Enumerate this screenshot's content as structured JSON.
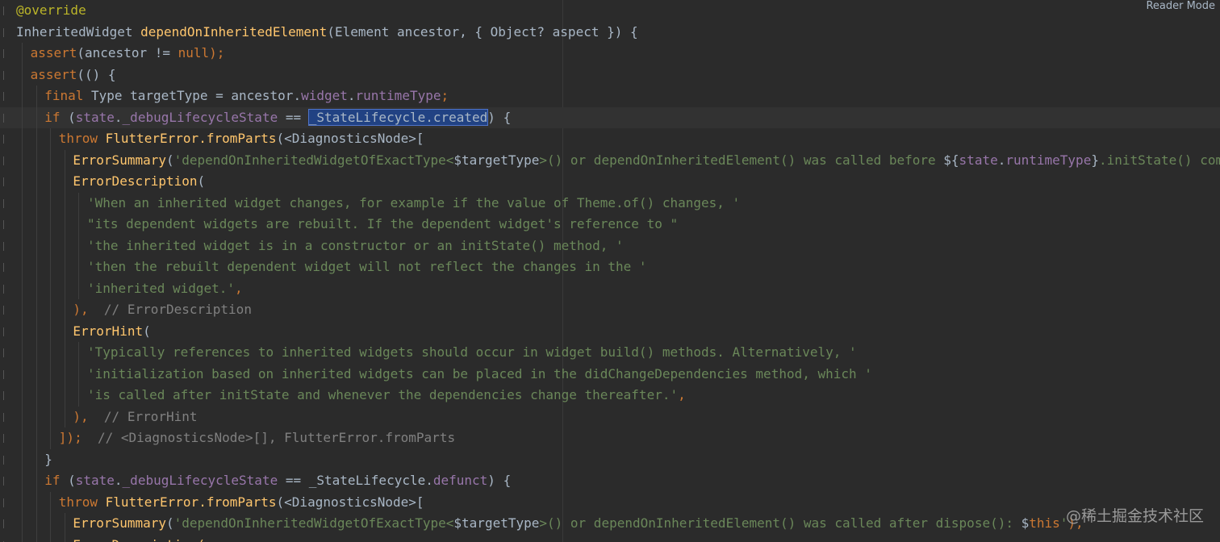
{
  "editor": {
    "reader_mode_label": "Reader Mode",
    "watermark": "@稀土掘金技术社区",
    "colors": {
      "background": "#2b2b2b",
      "plain": "#a9b7c6",
      "keyword": "#cc7832",
      "function": "#ffc66d",
      "field": "#9876aa",
      "string": "#6a8759",
      "comment": "#808080",
      "annotation": "#bbb529",
      "selection": "#214283"
    },
    "lines": [
      {
        "indent": 0,
        "tokens": [
          {
            "t": "@override",
            "c": "anno"
          }
        ]
      },
      {
        "indent": 0,
        "tokens": [
          {
            "t": "InheritedWidget ",
            "c": "plain"
          },
          {
            "t": "dependOnInheritedElement",
            "c": "fn"
          },
          {
            "t": "(Element ancestor, { Object? aspect }) {",
            "c": "plain"
          }
        ]
      },
      {
        "indent": 1,
        "tokens": [
          {
            "t": "assert",
            "c": "kw"
          },
          {
            "t": "(ancestor != ",
            "c": "plain"
          },
          {
            "t": "null",
            "c": "kw"
          },
          {
            "t": ");",
            "c": "kw"
          }
        ]
      },
      {
        "indent": 1,
        "tokens": [
          {
            "t": "assert",
            "c": "kw"
          },
          {
            "t": "(() {",
            "c": "plain"
          }
        ]
      },
      {
        "indent": 2,
        "tokens": [
          {
            "t": "final ",
            "c": "kw"
          },
          {
            "t": "Type targetType = ancestor.",
            "c": "plain"
          },
          {
            "t": "widget",
            "c": "field"
          },
          {
            "t": ".",
            "c": "plain"
          },
          {
            "t": "runtimeType",
            "c": "field"
          },
          {
            "t": ";",
            "c": "kw"
          }
        ]
      },
      {
        "indent": 2,
        "current": true,
        "tokens": [
          {
            "t": "if ",
            "c": "kw"
          },
          {
            "t": "(",
            "c": "plain"
          },
          {
            "t": "state",
            "c": "field"
          },
          {
            "t": ".",
            "c": "plain"
          },
          {
            "t": "_debugLifecycleState",
            "c": "field"
          },
          {
            "t": " == ",
            "c": "plain"
          },
          {
            "t": "_StateLifecycle.created",
            "c": "sel"
          },
          {
            "t": ") {",
            "c": "plain"
          }
        ]
      },
      {
        "indent": 3,
        "tokens": [
          {
            "t": "throw ",
            "c": "kw"
          },
          {
            "t": "FlutterError.",
            "c": "fn"
          },
          {
            "t": "fromParts",
            "c": "fn"
          },
          {
            "t": "(<DiagnosticsNode>[",
            "c": "plain"
          }
        ]
      },
      {
        "indent": 4,
        "tokens": [
          {
            "t": "ErrorSummary",
            "c": "fn"
          },
          {
            "t": "(",
            "c": "plain"
          },
          {
            "t": "'dependOnInheritedWidgetOfExactType<",
            "c": "str"
          },
          {
            "t": "$targetType",
            "c": "plain"
          },
          {
            "t": ">() or dependOnInheritedElement() was called before ",
            "c": "str"
          },
          {
            "t": "${",
            "c": "plain"
          },
          {
            "t": "state",
            "c": "field"
          },
          {
            "t": ".",
            "c": "plain"
          },
          {
            "t": "runtimeType",
            "c": "field"
          },
          {
            "t": "}",
            "c": "plain"
          },
          {
            "t": ".initState() completed.'",
            "c": "str"
          },
          {
            "t": "),",
            "c": "kw"
          }
        ]
      },
      {
        "indent": 4,
        "tokens": [
          {
            "t": "ErrorDescription",
            "c": "fn"
          },
          {
            "t": "(",
            "c": "plain"
          }
        ]
      },
      {
        "indent": 5,
        "tokens": [
          {
            "t": "'When an inherited widget changes, for example if the value of Theme.of() changes, '",
            "c": "str"
          }
        ]
      },
      {
        "indent": 5,
        "tokens": [
          {
            "t": "\"its dependent widgets are rebuilt. If the dependent widget's reference to \"",
            "c": "str"
          }
        ]
      },
      {
        "indent": 5,
        "tokens": [
          {
            "t": "'the inherited widget is in a constructor or an initState() method, '",
            "c": "str"
          }
        ]
      },
      {
        "indent": 5,
        "tokens": [
          {
            "t": "'then the rebuilt dependent widget will not reflect the changes in the '",
            "c": "str"
          }
        ]
      },
      {
        "indent": 5,
        "tokens": [
          {
            "t": "'inherited widget.'",
            "c": "str"
          },
          {
            "t": ",",
            "c": "kw"
          }
        ]
      },
      {
        "indent": 4,
        "tokens": [
          {
            "t": "),",
            "c": "kw"
          },
          {
            "t": "  // ErrorDescription",
            "c": "com"
          }
        ]
      },
      {
        "indent": 4,
        "tokens": [
          {
            "t": "ErrorHint",
            "c": "fn"
          },
          {
            "t": "(",
            "c": "plain"
          }
        ]
      },
      {
        "indent": 5,
        "tokens": [
          {
            "t": "'Typically references to inherited widgets should occur in widget build() methods. Alternatively, '",
            "c": "str"
          }
        ]
      },
      {
        "indent": 5,
        "tokens": [
          {
            "t": "'initialization based on inherited widgets can be placed in the didChangeDependencies method, which '",
            "c": "str"
          }
        ]
      },
      {
        "indent": 5,
        "tokens": [
          {
            "t": "'is called after initState and whenever the dependencies change thereafter.'",
            "c": "str"
          },
          {
            "t": ",",
            "c": "kw"
          }
        ]
      },
      {
        "indent": 4,
        "tokens": [
          {
            "t": "),",
            "c": "kw"
          },
          {
            "t": "  // ErrorHint",
            "c": "com"
          }
        ]
      },
      {
        "indent": 3,
        "tokens": [
          {
            "t": "]);",
            "c": "kw"
          },
          {
            "t": "  // <DiagnosticsNode>[], FlutterError.fromParts",
            "c": "com"
          }
        ]
      },
      {
        "indent": 2,
        "tokens": [
          {
            "t": "}",
            "c": "plain"
          }
        ]
      },
      {
        "indent": 2,
        "tokens": [
          {
            "t": "if ",
            "c": "kw"
          },
          {
            "t": "(",
            "c": "plain"
          },
          {
            "t": "state",
            "c": "field"
          },
          {
            "t": ".",
            "c": "plain"
          },
          {
            "t": "_debugLifecycleState",
            "c": "field"
          },
          {
            "t": " == _StateLifecycle.",
            "c": "plain"
          },
          {
            "t": "defunct",
            "c": "field"
          },
          {
            "t": ") {",
            "c": "plain"
          }
        ]
      },
      {
        "indent": 3,
        "tokens": [
          {
            "t": "throw ",
            "c": "kw"
          },
          {
            "t": "FlutterError.",
            "c": "fn"
          },
          {
            "t": "fromParts",
            "c": "fn"
          },
          {
            "t": "(<DiagnosticsNode>[",
            "c": "plain"
          }
        ]
      },
      {
        "indent": 4,
        "tokens": [
          {
            "t": "ErrorSummary",
            "c": "fn"
          },
          {
            "t": "(",
            "c": "plain"
          },
          {
            "t": "'dependOnInheritedWidgetOfExactType<",
            "c": "str"
          },
          {
            "t": "$targetType",
            "c": "plain"
          },
          {
            "t": ">() or dependOnInheritedElement() was called after dispose(): ",
            "c": "str"
          },
          {
            "t": "$",
            "c": "plain"
          },
          {
            "t": "this",
            "c": "kw"
          },
          {
            "t": "'",
            "c": "str"
          },
          {
            "t": "),",
            "c": "kw"
          }
        ]
      },
      {
        "indent": 4,
        "tokens": [
          {
            "t": "ErrorDescription(",
            "c": "fn"
          }
        ]
      }
    ]
  }
}
